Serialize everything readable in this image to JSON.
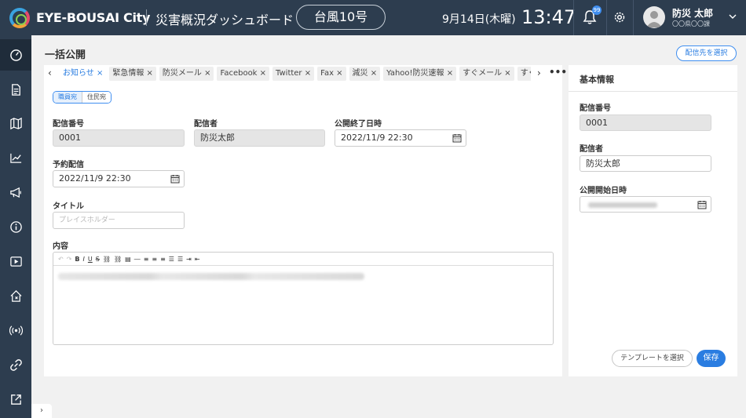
{
  "header": {
    "brand": "EYE-BOUSAI City",
    "dashboard_title": "災害概況ダッシュボード",
    "typhoon_label": "台風10号",
    "date": "9月14日(木曜)",
    "time": "13:47",
    "notification_count": "99",
    "user_name": "防災 太郎",
    "user_dept": "〇〇県〇〇課"
  },
  "sidebar": {
    "items": [
      "dashboard-icon",
      "document-icon",
      "map-icon",
      "chart-icon",
      "megaphone-icon",
      "info-icon",
      "video-icon",
      "evacuation-icon",
      "broadcast-icon",
      "link-icon",
      "external-link-icon"
    ]
  },
  "page": {
    "title": "一括公開",
    "select_destination": "配信先を選択"
  },
  "tabs": [
    {
      "label": "お知らせ ×",
      "active": true
    },
    {
      "label": "緊急情報 ×"
    },
    {
      "label": "防災メール ×"
    },
    {
      "label": "Facebook ×"
    },
    {
      "label": "Twitter ×"
    },
    {
      "label": "Fax ×"
    },
    {
      "label": "減災 ×"
    },
    {
      "label": "Yahoo!防災速報 ×"
    },
    {
      "label": "すぐメール ×"
    },
    {
      "label": "すぐ"
    }
  ],
  "audience": {
    "staff": "職員宛",
    "residents": "住民宛"
  },
  "form": {
    "delivery_number_label": "配信番号",
    "delivery_number": "0001",
    "sender_label": "配信者",
    "sender": "防災太郎",
    "end_date_label": "公開終了日時",
    "end_date": "2022/11/9 22:30",
    "scheduled_label": "予約配信",
    "scheduled": "2022/11/9 22:30",
    "title_label": "タイトル",
    "title_placeholder": "プレイスホルダー",
    "content_label": "内容"
  },
  "right_panel": {
    "title": "基本情報",
    "delivery_number_label": "配信番号",
    "delivery_number": "0001",
    "sender_label": "配信者",
    "sender": "防災太郎",
    "start_date_label": "公開開始日時"
  },
  "buttons": {
    "template": "テンプレートを選択",
    "save": "保存"
  },
  "colors": {
    "header_bg": "#2d3d4f",
    "accent": "#2a7de1"
  }
}
